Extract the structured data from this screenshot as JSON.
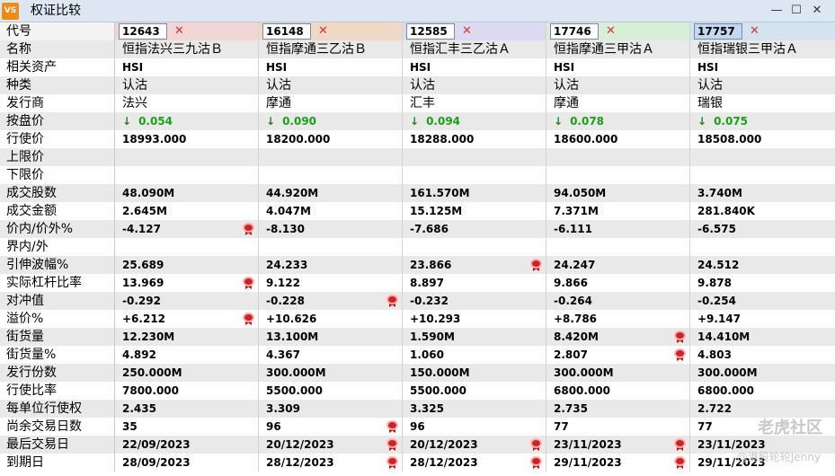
{
  "window": {
    "title": "权证比较",
    "app_icon_text": "VS",
    "minimize": "—",
    "maximize": "☐",
    "close": "✕"
  },
  "colors": {
    "col1": "#f2d6d6",
    "col2": "#efd8c4",
    "col3": "#dcdaf0",
    "col4": "#d6efd6",
    "col5": "#d4e4ef"
  },
  "code_label": "代号",
  "codes": [
    "12643",
    "16148",
    "12585",
    "17746",
    "17757"
  ],
  "labels": [
    "名称",
    "相关资产",
    "种类",
    "发行商",
    "按盘价",
    "行使价",
    "上限价",
    "下限价",
    "成交股数",
    "成交金额",
    "价内/价外%",
    "界内/外",
    "引伸波幅%",
    "实际杠杆比率",
    "对冲值",
    "溢价%",
    "街货量",
    "街货量%",
    "发行份数",
    "行使比率",
    "每单位行使权",
    "尚余交易日数",
    "最后交易日",
    "到期日"
  ],
  "rows": [
    [
      "恒指法兴三九沽Ｂ",
      "恒指摩通三乙沽Ｂ",
      "恒指汇丰三乙沽Ａ",
      "恒指摩通三甲沽Ａ",
      "恒指瑞银三甲沽Ａ"
    ],
    [
      "HSI",
      "HSI",
      "HSI",
      "HSI",
      "HSI"
    ],
    [
      "认沽",
      "认沽",
      "认沽",
      "认沽",
      "认沽"
    ],
    [
      "法兴",
      "摩通",
      "汇丰",
      "摩通",
      "瑞银"
    ],
    [
      "0.054",
      "0.090",
      "0.094",
      "0.078",
      "0.075"
    ],
    [
      "18993.000",
      "18200.000",
      "18288.000",
      "18600.000",
      "18508.000"
    ],
    [
      "",
      "",
      "",
      "",
      ""
    ],
    [
      "",
      "",
      "",
      "",
      ""
    ],
    [
      "48.090M",
      "44.920M",
      "161.570M",
      "94.050M",
      "3.740M"
    ],
    [
      "2.645M",
      "4.047M",
      "15.125M",
      "7.371M",
      "281.840K"
    ],
    [
      "-4.127",
      "-8.130",
      "-7.686",
      "-6.111",
      "-6.575"
    ],
    [
      "",
      "",
      "",
      "",
      ""
    ],
    [
      "25.689",
      "24.233",
      "23.866",
      "24.247",
      "24.512"
    ],
    [
      "13.969",
      "9.122",
      "8.897",
      "9.866",
      "9.878"
    ],
    [
      "-0.292",
      "-0.228",
      "-0.232",
      "-0.264",
      "-0.254"
    ],
    [
      "+6.212",
      "+10.626",
      "+10.293",
      "+8.786",
      "+9.147"
    ],
    [
      "12.230M",
      "13.100M",
      "1.590M",
      "8.420M",
      "14.410M"
    ],
    [
      "4.892",
      "4.367",
      "1.060",
      "2.807",
      "4.803"
    ],
    [
      "250.000M",
      "300.000M",
      "150.000M",
      "300.000M",
      "300.000M"
    ],
    [
      "7800.000",
      "5500.000",
      "5500.000",
      "6800.000",
      "6800.000"
    ],
    [
      "2.435",
      "3.309",
      "3.325",
      "2.735",
      "2.722"
    ],
    [
      "35",
      "96",
      "96",
      "77",
      "77"
    ],
    [
      "22/09/2023",
      "20/12/2023",
      "20/12/2023",
      "23/11/2023",
      "23/11/2023"
    ],
    [
      "28/09/2023",
      "28/12/2023",
      "28/12/2023",
      "29/11/2023",
      "29/11/2023"
    ]
  ],
  "badges": [
    [
      10,
      0
    ],
    [
      13,
      0
    ],
    [
      15,
      0
    ],
    [
      14,
      1
    ],
    [
      21,
      1
    ],
    [
      22,
      1
    ],
    [
      23,
      1
    ],
    [
      12,
      2
    ],
    [
      22,
      2
    ],
    [
      23,
      2
    ],
    [
      16,
      3
    ],
    [
      17,
      3
    ],
    [
      22,
      3
    ],
    [
      23,
      3
    ]
  ],
  "watermark": {
    "main": "老虎社区",
    "sub": "@港股轮轮Jenny"
  }
}
